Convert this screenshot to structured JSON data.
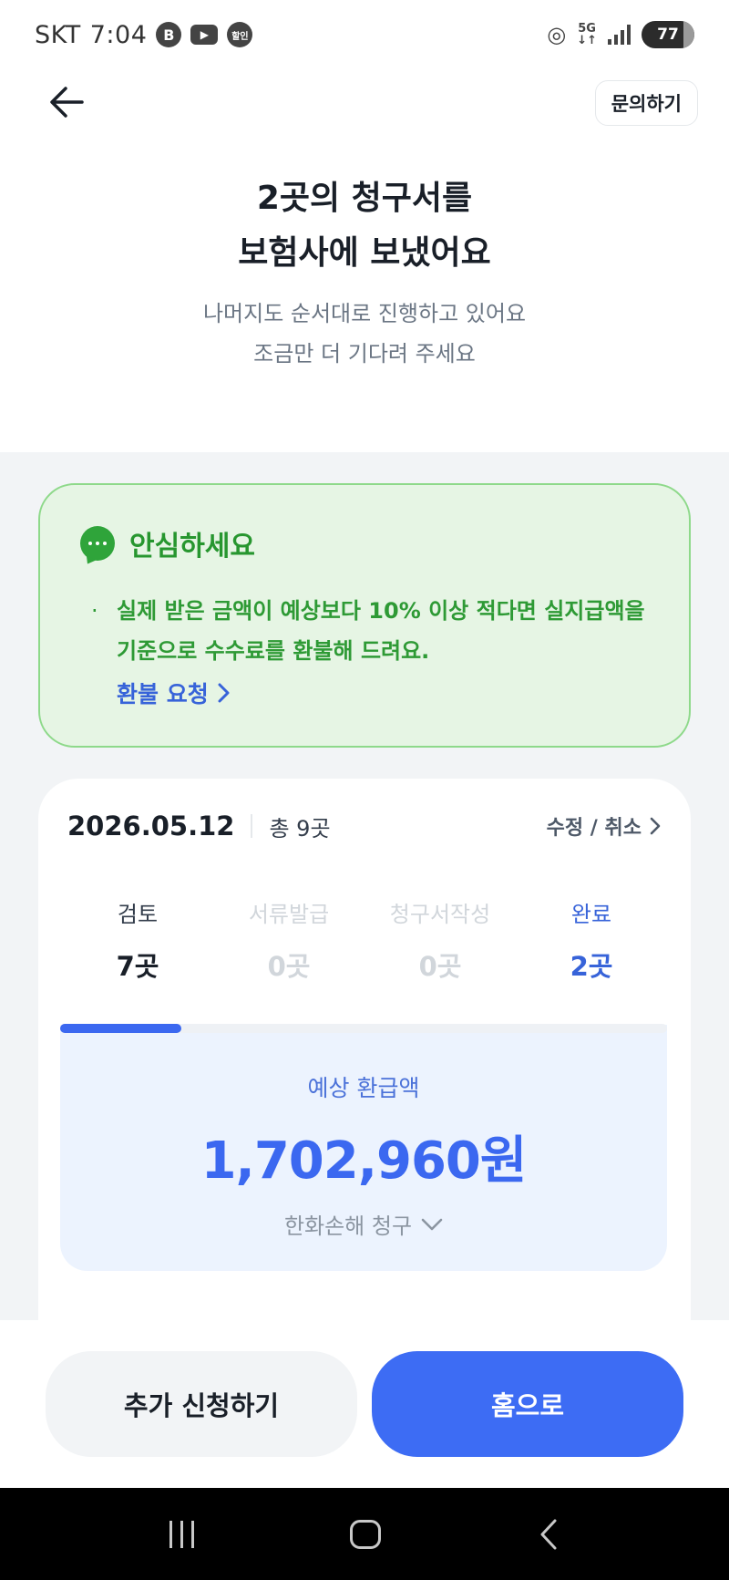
{
  "status_bar": {
    "carrier": "SKT",
    "time": "7:04",
    "icon_b": "B",
    "icon_sale": "할인",
    "network": "5G",
    "battery": "77"
  },
  "header": {
    "inquiry_label": "문의하기"
  },
  "hero": {
    "title_line1": "2곳의 청구서를",
    "title_line2": "보험사에 보냈어요",
    "sub_line1": "나머지도 순서대로 진행하고 있어요",
    "sub_line2": "조금만 더 기다려 주세요"
  },
  "reassure": {
    "title": "안심하세요",
    "bullet": "·",
    "text": "실제 받은 금액이 예상보다 10% 이상 적다면 실지급액을 기준으로 수수료를 환불해 드려요.",
    "link": "환불 요청",
    "color": "#2fa43a"
  },
  "status": {
    "date": "2026.05.12",
    "total": "총 9곳",
    "edit": "수정 / 취소",
    "steps": [
      {
        "label": "검토",
        "count": "7곳"
      },
      {
        "label": "서류발급",
        "count": "0곳"
      },
      {
        "label": "청구서작성",
        "count": "0곳"
      },
      {
        "label": "완료",
        "count": "2곳"
      }
    ],
    "progress_fraction": 0.2
  },
  "refund": {
    "label": "예상 환급액",
    "amount": "1,702,960원",
    "insurer": "한화손해 청구"
  },
  "buttons": {
    "add": "추가 신청하기",
    "home": "홈으로"
  },
  "colors": {
    "accent": "#3d6cf4",
    "green": "#2fa43a"
  }
}
